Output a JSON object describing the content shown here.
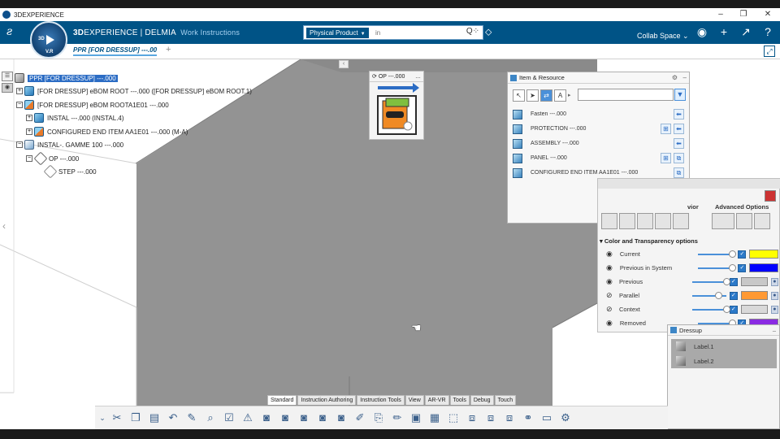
{
  "window": {
    "title": "3DEXPERIENCE",
    "controls": {
      "minimize": "–",
      "maximize": "❐",
      "close": "✕"
    }
  },
  "topbar": {
    "brand_prefix": "3D",
    "brand_main": "EXPERIENCE | DELMIA",
    "brand_app": "Work Instructions",
    "compass_label": "V.R",
    "search_category": "Physical Product",
    "search_placeholder": "in",
    "collab_space": "Collab Space ⌄"
  },
  "tabs": {
    "active_doc": "PPR [FOR DRESSUP] ---.00",
    "add": "+"
  },
  "tree": {
    "nodes": [
      {
        "label": "PPR [FOR DRESSUP] ---.000",
        "selected": true
      },
      {
        "label": "[FOR DRESSUP] eBOM ROOT ---.000 ([FOR DRESSUP] eBOM ROOT.1)"
      },
      {
        "label": "[FOR DRESSUP] eBOM ROOTA1E01 ---.000"
      },
      {
        "label": "INSTAL ---.000 (INSTAL.4)"
      },
      {
        "label": "CONFIGURED END ITEM AA1E01 ---.000 (M-A)"
      },
      {
        "label": "INSTAL-. GAMME 100 ---.000"
      },
      {
        "label": "OP ---.000"
      },
      {
        "label": "STEP ---.000"
      }
    ]
  },
  "op_panel": {
    "title": "OP ---.000"
  },
  "item_resource": {
    "title": "Item & Resource",
    "items": [
      {
        "label": "Fasten ---.000"
      },
      {
        "label": "PROTECTION ---.000"
      },
      {
        "label": "ASSEMBLY ---.000"
      },
      {
        "label": "PANEL ---.000"
      },
      {
        "label": "CONFIGURED END ITEM AA1E01 ---.000"
      }
    ]
  },
  "advanced": {
    "tab_behavior": "vior",
    "tab_advanced": "Advanced Options",
    "color_title": "Color and Transparency options",
    "rows": [
      {
        "label": "Current",
        "color": "#ffff00"
      },
      {
        "label": "Previous in System",
        "color": "#0000ff"
      },
      {
        "label": "Previous",
        "color": "#c8c8c8"
      },
      {
        "label": "Parallel",
        "color": "#ff9933"
      },
      {
        "label": "Context",
        "color": "#d9d9d9"
      },
      {
        "label": "Removed",
        "color": "#8a2be2"
      }
    ]
  },
  "dressup": {
    "title": "Dressup",
    "items": [
      {
        "label": "Label.1"
      },
      {
        "label": "Label.2"
      }
    ]
  },
  "toolbar": {
    "tabs": [
      "Standard",
      "Instruction Authoring",
      "Instruction Tools",
      "View",
      "AR-VR",
      "Tools",
      "Debug",
      "Touch"
    ],
    "active_tab": "Standard"
  },
  "icons": {
    "search": "search-icon",
    "tag": "tag-icon",
    "user": "user-icon",
    "add": "plus-icon",
    "share": "share-icon",
    "help": "help-icon"
  }
}
